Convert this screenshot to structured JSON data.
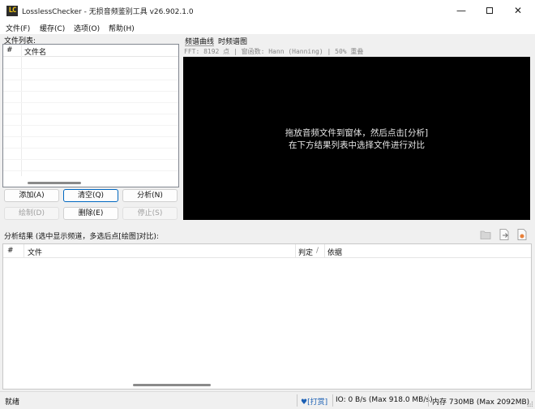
{
  "window": {
    "app_icon": "LC",
    "title": "LosslessChecker - 无损音频鉴别工具 v26.902.1.0",
    "controls": {
      "minimize": "—",
      "close": "✕"
    }
  },
  "menu": {
    "items": [
      {
        "label": "文件(F)"
      },
      {
        "label": "缓存(C)"
      },
      {
        "label": "选项(O)"
      },
      {
        "label": "帮助(H)"
      }
    ]
  },
  "file_panel": {
    "label": "文件列表:",
    "columns": {
      "index": "#",
      "name": "文件名"
    },
    "rows": []
  },
  "buttons": {
    "add": "添加(A)",
    "clear": "清空(Q)",
    "analyze": "分析(N)",
    "draw": "绘制(D)",
    "delete": "删除(E)",
    "stop": "停止(S)"
  },
  "view_tabs": {
    "items": [
      {
        "label": "频谱曲线",
        "active": true
      },
      {
        "label": "时频谱图",
        "active": false
      }
    ]
  },
  "spectrum": {
    "info": "FFT: 8192 点 | 窗函数: Hann (Hanning) | 50% 重叠",
    "message_line1": "拖放音频文件到窗体，然后点击[分析]",
    "message_line2": "在下方结果列表中选择文件进行对比",
    "background": "#000000"
  },
  "results": {
    "label": "分析结果 (选中显示频道，多选后点[绘图]对比):",
    "toolbar_icons": [
      "folder-icon",
      "export-icon",
      "report-icon"
    ],
    "columns": {
      "index": "#",
      "file": "文件",
      "verdict": "判定",
      "sort_indicator": "/",
      "basis": "依据"
    },
    "rows": []
  },
  "status": {
    "state": "就绪",
    "donate_icon": "heart-icon",
    "donate": "[打赏]",
    "io": "IO: 0 B/s (Max 918.0 MB/s)",
    "memory": "内存 730MB (Max 2092MB)"
  },
  "colors": {
    "accent": "#0067c0",
    "link": "#1a5fb4",
    "window_bg": "#f0f0f0"
  }
}
